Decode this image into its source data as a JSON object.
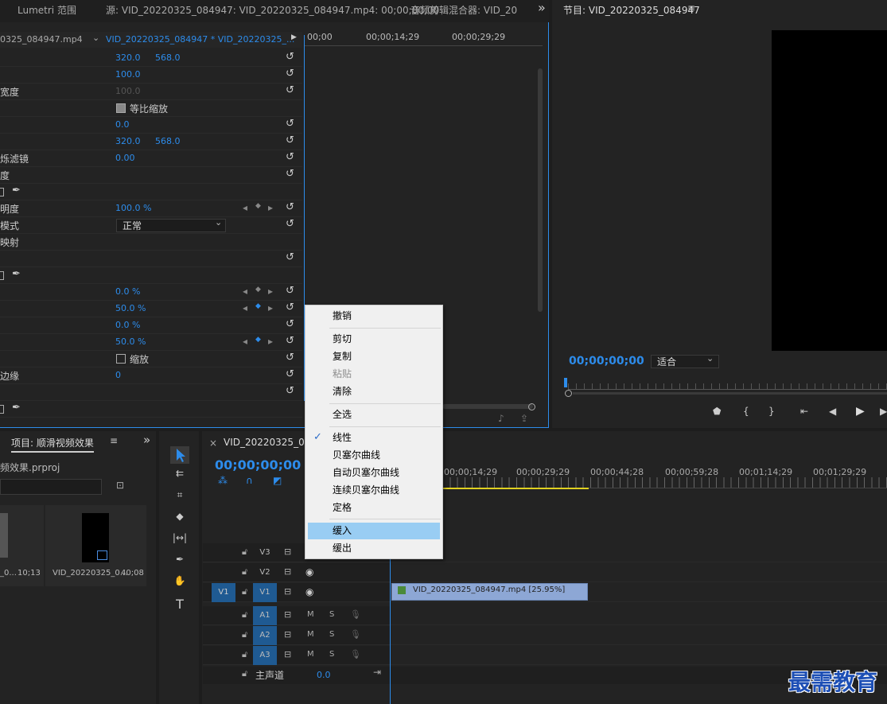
{
  "panel_tabs": {
    "lumetri": "Lumetri 范围",
    "source": "源: VID_20220325_084947: VID_20220325_084947.mp4: 00;00;00;00",
    "audio_mixer": "音频剪辑混合器: VID_20",
    "overflow": "»"
  },
  "effect_controls": {
    "source_clip": "0325_084947.mp4",
    "sequence_clip": "VID_20220325_084947 * VID_20220325_...",
    "timecodes": [
      "00;00",
      "00;00;14;29",
      "00;00;29;29"
    ],
    "rows": [
      {
        "label": "",
        "v1": "320.0",
        "v2": "568.0",
        "blue": true
      },
      {
        "label": "",
        "v1": "100.0",
        "v2": "",
        "blue": true
      },
      {
        "label": "宽度",
        "v1": "100.0",
        "v2": "",
        "blue": false
      },
      {
        "label": "",
        "v1": "等比缩放",
        "v2": "",
        "checkbox": true
      },
      {
        "label": "",
        "v1": "0.0",
        "v2": "",
        "blue": true
      },
      {
        "label": "",
        "v1": "320.0",
        "v2": "568.0",
        "blue": true
      },
      {
        "label": "烁滤镜",
        "v1": "0.00",
        "v2": "",
        "blue": true
      },
      {
        "label": "度",
        "v1": "",
        "v2": ""
      },
      {
        "label": "",
        "v1": "",
        "v2": "",
        "tools": true
      },
      {
        "label": "明度",
        "v1": "100.0 %",
        "v2": "",
        "blue": true,
        "kf": true
      },
      {
        "label": "模式",
        "v1": "正常",
        "v2": "",
        "dropdown": true
      },
      {
        "label": "映射",
        "v1": "",
        "v2": ""
      },
      {
        "label": "",
        "v1": "",
        "v2": ""
      },
      {
        "label": "",
        "v1": "",
        "v2": "",
        "tools": true
      },
      {
        "label": "",
        "v1": "0.0 %",
        "v2": "",
        "blue": true,
        "kf": true
      },
      {
        "label": "",
        "v1": "50.0 %",
        "v2": "",
        "blue": true,
        "kf": true
      },
      {
        "label": "",
        "v1": "0.0 %",
        "v2": "",
        "blue": true
      },
      {
        "label": "",
        "v1": "50.0 %",
        "v2": "",
        "blue": true,
        "kf": true
      },
      {
        "label": "",
        "v1": "缩放",
        "v2": "",
        "checkbox": true
      },
      {
        "label": "边缘",
        "v1": "0",
        "v2": "",
        "blue": true
      },
      {
        "label": "",
        "v1": "",
        "v2": ""
      },
      {
        "label": "",
        "v1": "",
        "v2": "",
        "tools": true
      }
    ]
  },
  "program_monitor": {
    "title": "节目: VID_20220325_084947",
    "timecode": "00;00;00;00",
    "fit": "适合"
  },
  "project": {
    "title": "项目: 顺滑视频效果",
    "file": "频效果.prproj",
    "items": [
      {
        "name": "_0...",
        "duration": "10;13"
      },
      {
        "name": "VID_20220325_0...",
        "duration": "40;08"
      }
    ]
  },
  "context_menu": {
    "items": [
      {
        "label": "撤销",
        "state": "normal"
      },
      {
        "label": "剪切",
        "state": "normal"
      },
      {
        "label": "复制",
        "state": "normal"
      },
      {
        "label": "粘贴",
        "state": "disabled"
      },
      {
        "label": "清除",
        "state": "normal"
      },
      {
        "label": "全选",
        "state": "normal"
      },
      {
        "label": "线性",
        "state": "checked"
      },
      {
        "label": "贝塞尔曲线",
        "state": "normal"
      },
      {
        "label": "自动贝塞尔曲线",
        "state": "normal"
      },
      {
        "label": "连续贝塞尔曲线",
        "state": "normal"
      },
      {
        "label": "定格",
        "state": "normal"
      },
      {
        "label": "缓入",
        "state": "highlighted"
      },
      {
        "label": "缓出",
        "state": "normal"
      }
    ]
  },
  "timeline": {
    "tab": "VID_20220325_084",
    "close": "×",
    "timecode": "00;00;00;00",
    "ruler": [
      "00;00;14;29",
      "00;00;29;29",
      "00;00;44;28",
      "00;00;59;28",
      "00;01;14;29",
      "00;01;29;29"
    ],
    "clip": "VID_20220325_084947.mp4 [25.95%]",
    "tracks": [
      {
        "name": "V3",
        "src": ""
      },
      {
        "name": "V2",
        "src": ""
      },
      {
        "name": "V1",
        "src": "V1"
      },
      {
        "name": "A1",
        "src": ""
      },
      {
        "name": "A2",
        "src": ""
      },
      {
        "name": "A3",
        "src": ""
      }
    ],
    "master": "主声道",
    "master_val": "0.0",
    "m": "M",
    "s": "S"
  },
  "watermark": "最需教育"
}
